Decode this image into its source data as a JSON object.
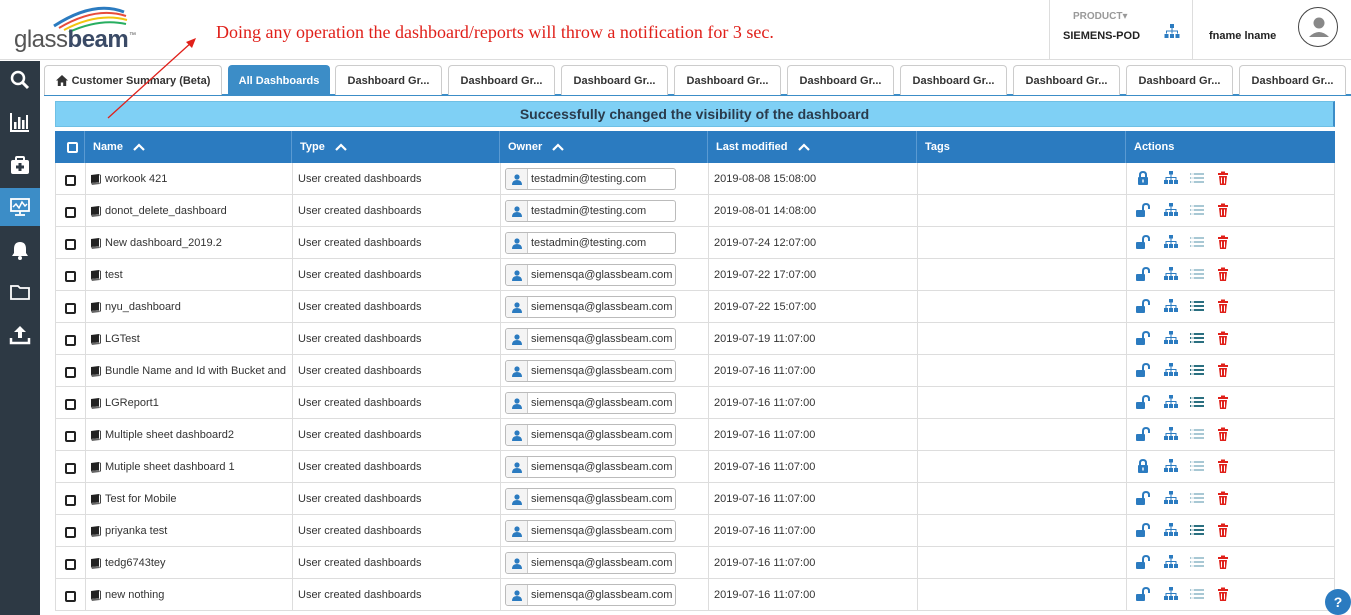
{
  "header": {
    "logo_text": "glassbeam",
    "logo_tm": "™",
    "notice": "Doing any operation the dashboard/reports will throw a notification for 3 sec.",
    "product_label": "PRODUCT",
    "product_value": "SIEMENS-POD",
    "user_name": "fname lname"
  },
  "sidebar": {
    "items": [
      "search-icon",
      "bar-chart-icon",
      "medkit-icon",
      "dashboard-monitor-icon",
      "bell-icon",
      "folder-icon",
      "upload-icon"
    ],
    "active_index": 3
  },
  "tabs": [
    {
      "label": "Customer Summary (Beta)",
      "icon": "home-icon"
    },
    {
      "label": "All Dashboards",
      "active": true
    },
    {
      "label": "Dashboard Gr..."
    },
    {
      "label": "Dashboard Gr..."
    },
    {
      "label": "Dashboard Gr..."
    },
    {
      "label": "Dashboard Gr..."
    },
    {
      "label": "Dashboard Gr..."
    },
    {
      "label": "Dashboard Gr..."
    },
    {
      "label": "Dashboard Gr..."
    },
    {
      "label": "Dashboard Gr..."
    },
    {
      "label": "Dashboard Gr..."
    }
  ],
  "banner": "Successfully changed the visibility of the dashboard",
  "table": {
    "columns": {
      "name": "Name",
      "type": "Type",
      "owner": "Owner",
      "last_modified": "Last modified",
      "tags": "Tags",
      "actions": "Actions"
    },
    "rows": [
      {
        "name": "workook 421",
        "type": "User created dashboards",
        "owner": "testadmin@testing.com",
        "modified": "2019-08-08 15:08:00",
        "locked": true,
        "list_active": false
      },
      {
        "name": "donot_delete_dashboard",
        "type": "User created dashboards",
        "owner": "testadmin@testing.com",
        "modified": "2019-08-01 14:08:00",
        "locked": false,
        "list_active": false
      },
      {
        "name": "New dashboard_2019.2",
        "type": "User created dashboards",
        "owner": "testadmin@testing.com",
        "modified": "2019-07-24 12:07:00",
        "locked": false,
        "list_active": false
      },
      {
        "name": "test",
        "type": "User created dashboards",
        "owner": "siemensqa@glassbeam.com",
        "modified": "2019-07-22 17:07:00",
        "locked": false,
        "list_active": false
      },
      {
        "name": "nyu_dashboard",
        "type": "User created dashboards",
        "owner": "siemensqa@glassbeam.com",
        "modified": "2019-07-22 15:07:00",
        "locked": false,
        "list_active": true
      },
      {
        "name": "LGTest",
        "type": "User created dashboards",
        "owner": "siemensqa@glassbeam.com",
        "modified": "2019-07-19 11:07:00",
        "locked": false,
        "list_active": true
      },
      {
        "name": "Bundle Name and Id with Bucket and ...",
        "type": "User created dashboards",
        "owner": "siemensqa@glassbeam.com",
        "modified": "2019-07-16 11:07:00",
        "locked": false,
        "list_active": true
      },
      {
        "name": "LGReport1",
        "type": "User created dashboards",
        "owner": "siemensqa@glassbeam.com",
        "modified": "2019-07-16 11:07:00",
        "locked": false,
        "list_active": true
      },
      {
        "name": "Multiple sheet dashboard2",
        "type": "User created dashboards",
        "owner": "siemensqa@glassbeam.com",
        "modified": "2019-07-16 11:07:00",
        "locked": false,
        "list_active": false
      },
      {
        "name": "Mutiple sheet dashboard 1",
        "type": "User created dashboards",
        "owner": "siemensqa@glassbeam.com",
        "modified": "2019-07-16 11:07:00",
        "locked": true,
        "list_active": false
      },
      {
        "name": "Test for Mobile",
        "type": "User created dashboards",
        "owner": "siemensqa@glassbeam.com",
        "modified": "2019-07-16 11:07:00",
        "locked": false,
        "list_active": false
      },
      {
        "name": "priyanka test",
        "type": "User created dashboards",
        "owner": "siemensqa@glassbeam.com",
        "modified": "2019-07-16 11:07:00",
        "locked": false,
        "list_active": true
      },
      {
        "name": "tedg6743tey",
        "type": "User created dashboards",
        "owner": "siemensqa@glassbeam.com",
        "modified": "2019-07-16 11:07:00",
        "locked": false,
        "list_active": false
      },
      {
        "name": "new nothing",
        "type": "User created dashboards",
        "owner": "siemensqa@glassbeam.com",
        "modified": "2019-07-16 11:07:00",
        "locked": false,
        "list_active": false
      }
    ]
  },
  "help_label": "?",
  "colors": {
    "accent": "#2b7bc0",
    "sidebar": "#2d3944",
    "banner": "#7fd0f5",
    "notice": "#e0201a",
    "delete": "#e0201a"
  }
}
